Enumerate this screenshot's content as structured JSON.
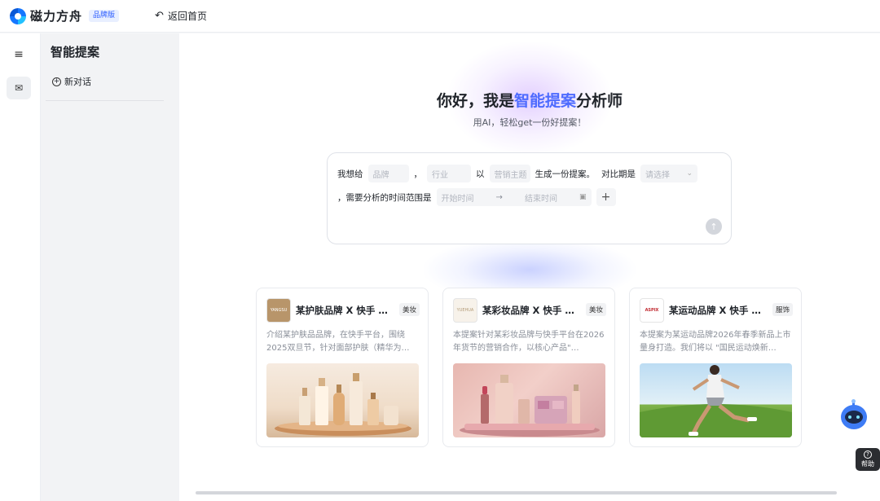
{
  "topbar": {
    "brand_name": "磁力方舟",
    "brand_badge": "品牌版",
    "back_home": "返回首页"
  },
  "rail": {
    "menu_icon": "≡",
    "mail_icon": "✉"
  },
  "sidebar": {
    "title": "智能提案",
    "new_chat": "新对话"
  },
  "hero": {
    "headline_prefix": "你好，我是",
    "headline_accent": "智能提案",
    "headline_suffix": "分析师",
    "subline": "用AI，轻松get一份好提案！",
    "accent_color": "#4e6bff"
  },
  "prompt": {
    "text_intro": "我想给",
    "brand_placeholder": "品牌",
    "comma1": "，",
    "industry_placeholder": "行业",
    "text_with": "以",
    "topic_placeholder": "营销主题",
    "text_generate": "生成一份提案。",
    "text_compare": "对比期是",
    "select_placeholder": "请选择",
    "text_range": "，需要分析的时间范围是",
    "start_placeholder": "开始时间",
    "range_sep": "→",
    "end_placeholder": "结束时间",
    "add_icon": "+",
    "send_icon": "↑"
  },
  "cards": [
    {
      "title": "某护肤品牌 X 快手 …",
      "tag": "美妆",
      "desc": "介绍某护肤品品牌，在快手平台，围绕2025双旦节，针对面部护肤（精华为…",
      "logo_text": "YANGSU"
    },
    {
      "title": "某彩妆品牌 X 快手 …",
      "tag": "美妆",
      "desc": "本提案针对某彩妆品牌与快手平台在2026年货节的营销合作，以核心产品\"…",
      "logo_text": "YUEHUA"
    },
    {
      "title": "某运动品牌 X 快手 …",
      "tag": "服饰",
      "desc": "本提案为某运动品牌2026年春季新品上市量身打造。我们将以 \"国民运动焕新…",
      "logo_text": "ASPIX"
    }
  ],
  "help": {
    "label": "帮助",
    "icon": "?"
  }
}
